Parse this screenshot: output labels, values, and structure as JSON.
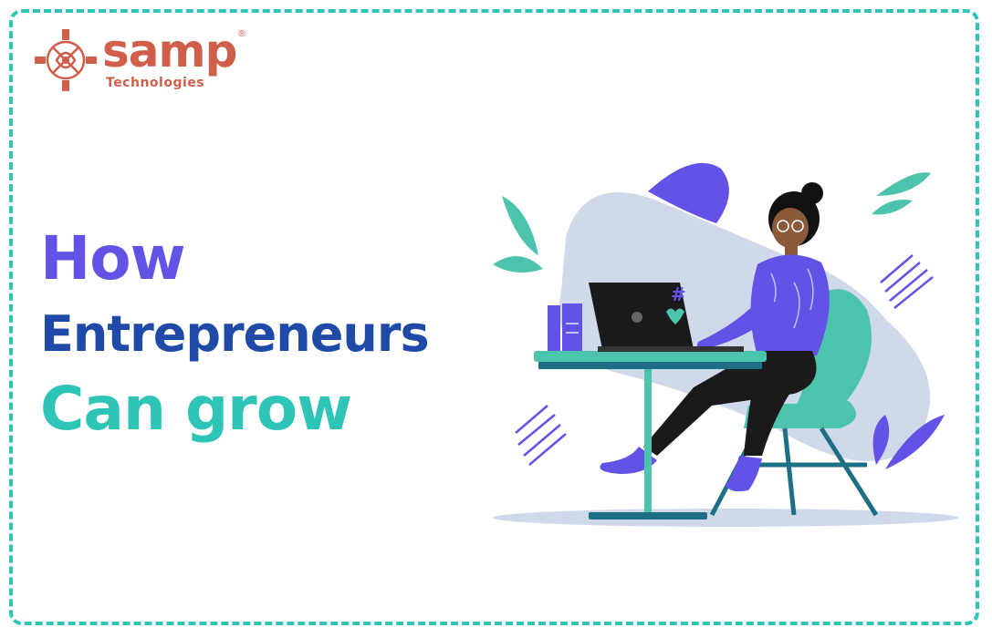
{
  "brand": {
    "name": "samp",
    "subtitle": "Technologies",
    "registered_mark": "®",
    "color": "#cf5f4a"
  },
  "headline": {
    "line1": "How",
    "line2": "Entrepreneurs",
    "line3": "Can grow",
    "colors": [
      "#6352e6",
      "#1f4aa8",
      "#2ec4b6"
    ]
  },
  "frame": {
    "border_color": "#2ec4b6"
  },
  "illustration": {
    "subject": "woman-working-on-laptop",
    "laptop_sticker": "#"
  }
}
